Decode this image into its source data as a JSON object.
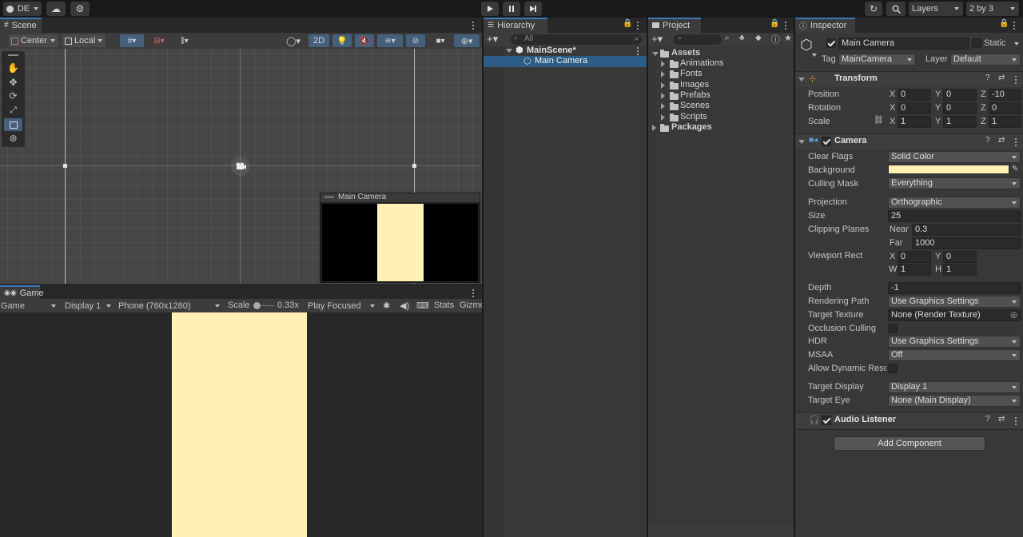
{
  "toolbar": {
    "account_label": "DE",
    "layers_label": "Layers",
    "layout_label": "2 by 3"
  },
  "scene": {
    "tab_label": "Scene",
    "pivot_label": "Center",
    "space_label": "Local",
    "mode_2d_label": "2D",
    "camera_preview_title": "Main Camera"
  },
  "game": {
    "tab_label": "Game",
    "mode_label": "Game",
    "display_label": "Display 1",
    "resolution_label": "Phone (760x1280)",
    "scale_label": "Scale",
    "scale_value": "0.33x",
    "play_focused_label": "Play Focused",
    "stats_label": "Stats",
    "gizmos_label": "Gizmo",
    "scale_slider_fraction": 0.0
  },
  "hierarchy": {
    "tab_label": "Hierarchy",
    "search_placeholder": "All",
    "scene_name": "MainScene*",
    "items": [
      "Main Camera"
    ]
  },
  "project": {
    "tab_label": "Project",
    "root": "Assets",
    "folders": [
      "Animations",
      "Fonts",
      "Images",
      "Prefabs",
      "Scenes",
      "Scripts"
    ],
    "packages": "Packages"
  },
  "inspector": {
    "tab_label": "Inspector",
    "object_name": "Main Camera",
    "static_label": "Static",
    "tag_label": "Tag",
    "tag_value": "MainCamera",
    "layer_label": "Layer",
    "layer_value": "Default",
    "transform": {
      "title": "Transform",
      "rows": [
        {
          "label": "Position",
          "x": "0",
          "y": "0",
          "z": "-10"
        },
        {
          "label": "Rotation",
          "x": "0",
          "y": "0",
          "z": "0"
        },
        {
          "label": "Scale",
          "x": "1",
          "y": "1",
          "z": "1"
        }
      ],
      "axis_x": "X",
      "axis_y": "Y",
      "axis_z": "Z"
    },
    "camera": {
      "title": "Camera",
      "clear_flags_label": "Clear Flags",
      "clear_flags_value": "Solid Color",
      "background_label": "Background",
      "background_color": "#FFF1B5",
      "culling_mask_label": "Culling Mask",
      "culling_mask_value": "Everything",
      "projection_label": "Projection",
      "projection_value": "Orthographic",
      "size_label": "Size",
      "size_value": "25",
      "clipping_label": "Clipping Planes",
      "near_label": "Near",
      "near_value": "0.3",
      "far_label": "Far",
      "far_value": "1000",
      "viewport_label": "Viewport Rect",
      "vp_x": "0",
      "vp_y": "0",
      "vp_w": "1",
      "vp_h": "1",
      "vp_x_label": "X",
      "vp_y_label": "Y",
      "vp_w_label": "W",
      "vp_h_label": "H",
      "depth_label": "Depth",
      "depth_value": "-1",
      "rendering_path_label": "Rendering Path",
      "rendering_path_value": "Use Graphics Settings",
      "target_texture_label": "Target Texture",
      "target_texture_value": "None (Render Texture)",
      "occlusion_label": "Occlusion Culling",
      "hdr_label": "HDR",
      "hdr_value": "Use Graphics Settings",
      "msaa_label": "MSAA",
      "msaa_value": "Off",
      "dynamic_res_label": "Allow Dynamic Reso",
      "target_display_label": "Target Display",
      "target_display_value": "Display 1",
      "target_eye_label": "Target Eye",
      "target_eye_value": "None (Main Display)"
    },
    "audio_listener": {
      "title": "Audio Listener"
    },
    "add_component_label": "Add Component"
  },
  "colors": {
    "camera_background": "#FFF1B5",
    "selection": "#2c5d87",
    "accent_tab": "#3a79bb"
  }
}
